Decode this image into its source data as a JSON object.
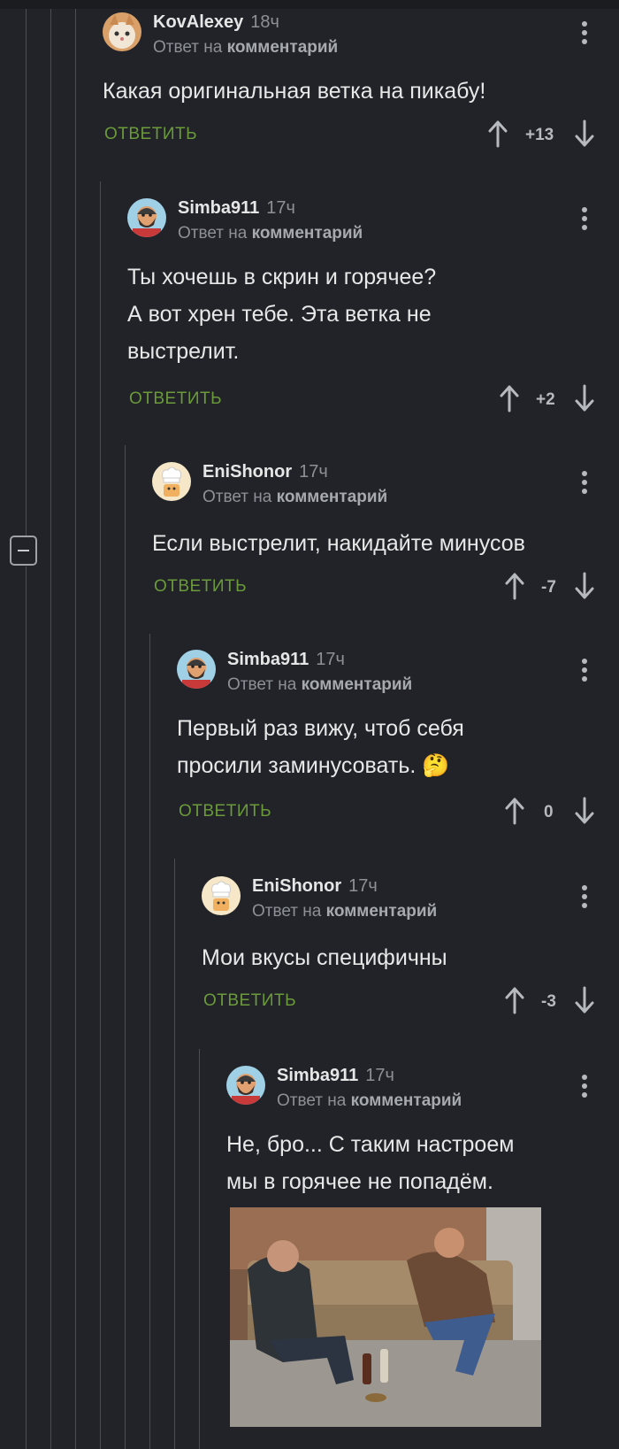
{
  "reply_label": "Ответ на",
  "reply_target": "комментарий",
  "answer_label": "ОТВЕТИТЬ",
  "comments": [
    {
      "author": "KovAlexey",
      "time": "18ч",
      "text": [
        "Какая оригинальная ветка на пикабу!"
      ],
      "rating": "+13",
      "avatar": "cat-avatar"
    },
    {
      "author": "Simba911",
      "time": "17ч",
      "text": [
        "Ты хочешь в скрин и горячее?",
        "А вот хрен тебе. Эта ветка не",
        "выстрелит."
      ],
      "rating": "+2",
      "avatar": "bearded-avatar"
    },
    {
      "author": "EniShonor",
      "time": "17ч",
      "text": [
        "Если выстрелит, накидайте минусов"
      ],
      "rating": "-7",
      "avatar": "chef-avatar"
    },
    {
      "author": "Simba911",
      "time": "17ч",
      "text": [
        "Первый раз вижу, чтоб себя",
        "просили заминусовать."
      ],
      "emoji": "🤔",
      "rating": "0",
      "avatar": "bearded-avatar"
    },
    {
      "author": "EniShonor",
      "time": "17ч",
      "text": [
        "Мои вкусы специфичны"
      ],
      "rating": "-3",
      "avatar": "chef-avatar"
    },
    {
      "author": "Simba911",
      "time": "17ч",
      "text": [
        "Не, бро... С таким настроем",
        "мы в горячее не попадём."
      ],
      "avatar": "bearded-avatar",
      "image": "two-men-on-sofa-photo"
    }
  ],
  "colors": {
    "background": "#212328",
    "answer": "#6a9a3a",
    "thread_line": "#4a4d53",
    "muted": "#8d9096"
  }
}
